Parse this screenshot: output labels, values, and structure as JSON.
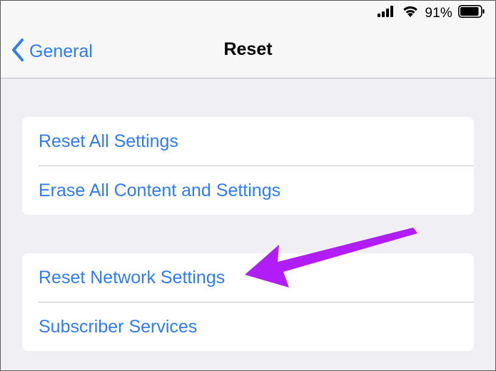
{
  "status_bar": {
    "battery_percent": "91%",
    "battery_level": 0.91,
    "signal_bars": 4,
    "wifi": true
  },
  "nav": {
    "back_label": "General",
    "title": "Reset"
  },
  "groups": [
    {
      "items": [
        {
          "label": "Reset All Settings"
        },
        {
          "label": "Erase All Content and Settings"
        }
      ]
    },
    {
      "items": [
        {
          "label": "Reset Network Settings"
        },
        {
          "label": "Subscriber Services"
        }
      ]
    }
  ],
  "annotation": {
    "arrow_color": "#b01df6",
    "points_to": "Reset Network Settings"
  },
  "colors": {
    "accent": "#2f7cf6",
    "background": "#efeff4",
    "bar_background": "#f7f7f7",
    "arrow": "#b01df6"
  }
}
